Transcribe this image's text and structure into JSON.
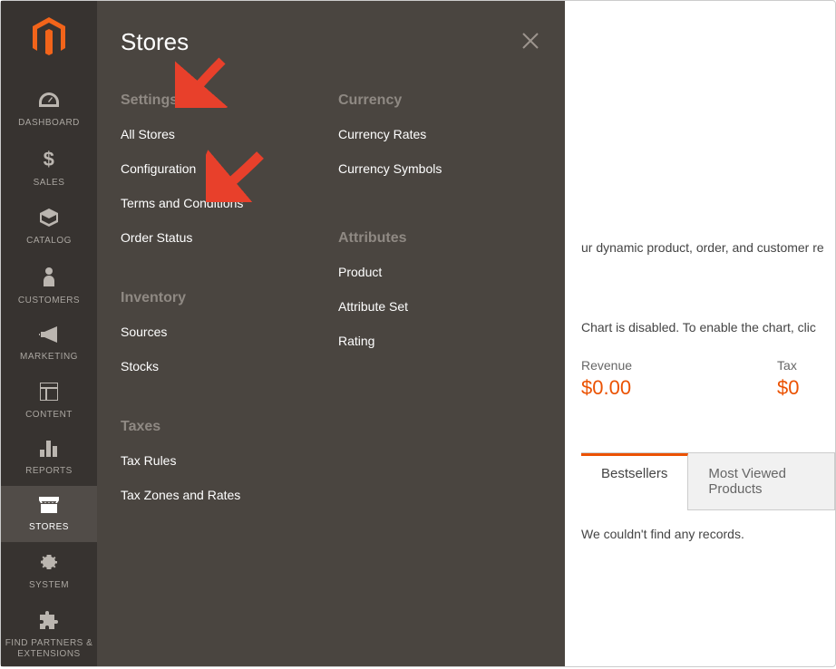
{
  "sidebar": {
    "items": [
      {
        "label": "DASHBOARD"
      },
      {
        "label": "SALES"
      },
      {
        "label": "CATALOG"
      },
      {
        "label": "CUSTOMERS"
      },
      {
        "label": "MARKETING"
      },
      {
        "label": "CONTENT"
      },
      {
        "label": "REPORTS"
      },
      {
        "label": "STORES"
      },
      {
        "label": "SYSTEM"
      },
      {
        "label": "FIND PARTNERS & EXTENSIONS"
      }
    ]
  },
  "flyout": {
    "title": "Stores",
    "col1": {
      "settings": {
        "heading": "Settings",
        "links": [
          "All Stores",
          "Configuration",
          "Terms and Conditions",
          "Order Status"
        ]
      },
      "inventory": {
        "heading": "Inventory",
        "links": [
          "Sources",
          "Stocks"
        ]
      },
      "taxes": {
        "heading": "Taxes",
        "links": [
          "Tax Rules",
          "Tax Zones and Rates"
        ]
      }
    },
    "col2": {
      "currency": {
        "heading": "Currency",
        "links": [
          "Currency Rates",
          "Currency Symbols"
        ]
      },
      "attributes": {
        "heading": "Attributes",
        "links": [
          "Product",
          "Attribute Set",
          "Rating"
        ]
      }
    }
  },
  "main": {
    "intro": "ur dynamic product, order, and customer re",
    "chart_disabled": "Chart is disabled. To enable the chart, clic",
    "stats": {
      "revenue_label": "Revenue",
      "revenue_value": "$0.00",
      "tax_label": "Tax",
      "tax_value": "$0"
    },
    "tabs": {
      "bestsellers": "Bestsellers",
      "most_viewed": "Most Viewed Products"
    },
    "empty": "We couldn't find any records."
  }
}
